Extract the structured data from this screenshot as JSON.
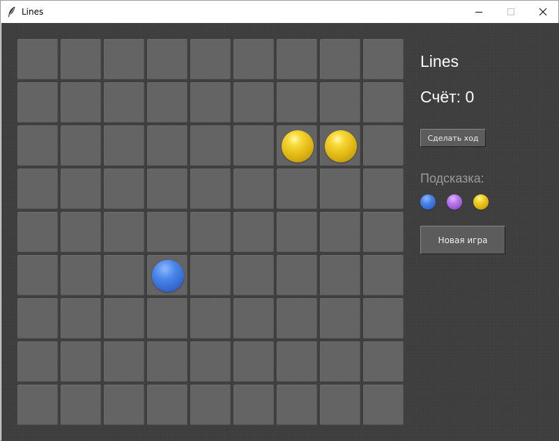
{
  "window": {
    "title": "Lines"
  },
  "board": {
    "rows": 9,
    "cols": 9,
    "balls": [
      {
        "row": 2,
        "col": 6,
        "color": "yellow"
      },
      {
        "row": 2,
        "col": 7,
        "color": "yellow"
      },
      {
        "row": 5,
        "col": 3,
        "color": "blue"
      }
    ]
  },
  "sidebar": {
    "title": "Lines",
    "score_text": "Счёт: 0",
    "move_button": "Сделать ход",
    "hint_label": "Подсказка:",
    "hint_balls": [
      "blue",
      "purple",
      "yellow"
    ],
    "new_game_button": "Новая игра"
  },
  "colors": {
    "background": "#3e3e3e",
    "cell": "#646464",
    "yellow": "#e8c21a",
    "blue": "#3f78e0",
    "purple": "#ad6ee6"
  }
}
